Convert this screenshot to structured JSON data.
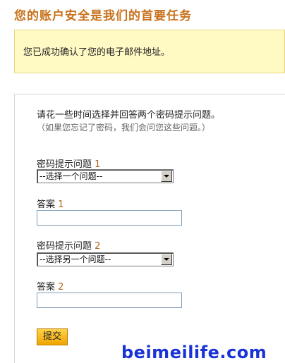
{
  "page": {
    "title": "您的账户安全是我们的首要任务"
  },
  "notice": {
    "message": "您已成功确认了您的电子邮件地址。"
  },
  "form": {
    "intro": "请花一些时间选择并回答两个密码提示问题。",
    "hint": "（如果您忘记了密码，我们会问您这些问题。）",
    "question1_label": "密码提示问题",
    "question1_num": "1",
    "question1_selected": "--选择一个问题--",
    "answer1_label": "答案",
    "answer1_num": "1",
    "answer1_value": "",
    "question2_label": "密码提示问题",
    "question2_num": "2",
    "question2_selected": "--选择另一个问题--",
    "answer2_label": "答案",
    "answer2_num": "2",
    "answer2_value": "",
    "submit_label": "提交"
  },
  "watermark": "beimeilife.com",
  "colors": {
    "title": "#c8721c",
    "notice_bg": "#fff9c4",
    "button": "#f0a500",
    "watermark": "#1a33d6"
  }
}
